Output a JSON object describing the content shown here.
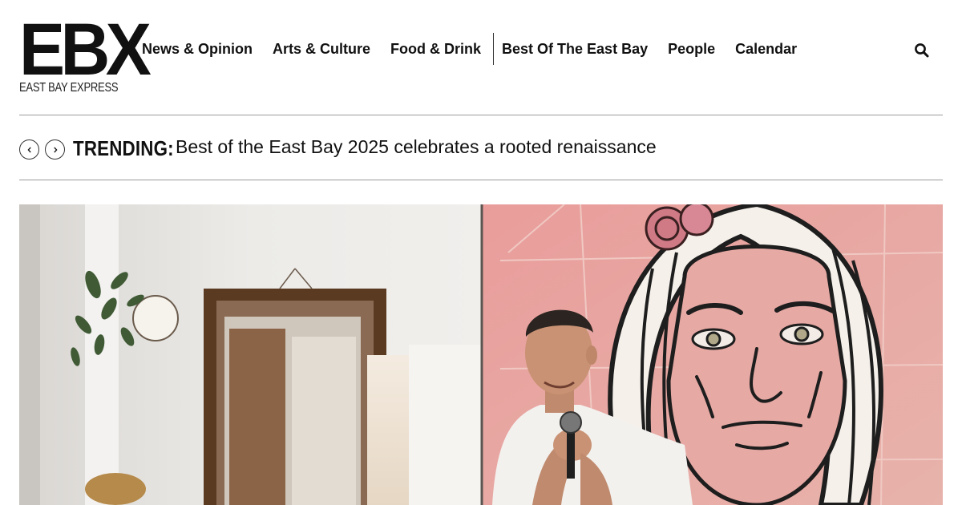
{
  "header": {
    "logo_mark": "EBX",
    "logo_subtitle": "EAST BAY EXPRESS",
    "nav": [
      {
        "label": "News & Opinion"
      },
      {
        "label": "Arts & Culture"
      },
      {
        "label": "Food & Drink"
      },
      {
        "label": "Best Of The East Bay"
      },
      {
        "label": "People"
      },
      {
        "label": "Calendar"
      }
    ],
    "search_icon": "search-icon"
  },
  "trending": {
    "label": "TRENDING:",
    "headline": "Best of the East Bay 2025 celebrates a rooted renaissance",
    "prev_icon": "chevron-left-icon",
    "next_icon": "chevron-right-icon"
  },
  "hero": {
    "image": "photo of a man speaking into a microphone in front of a large pink mural of a woman's face"
  },
  "colors": {
    "text": "#111111",
    "rule": "#9a9a9a",
    "mural_pink": "#e8a3a0"
  }
}
